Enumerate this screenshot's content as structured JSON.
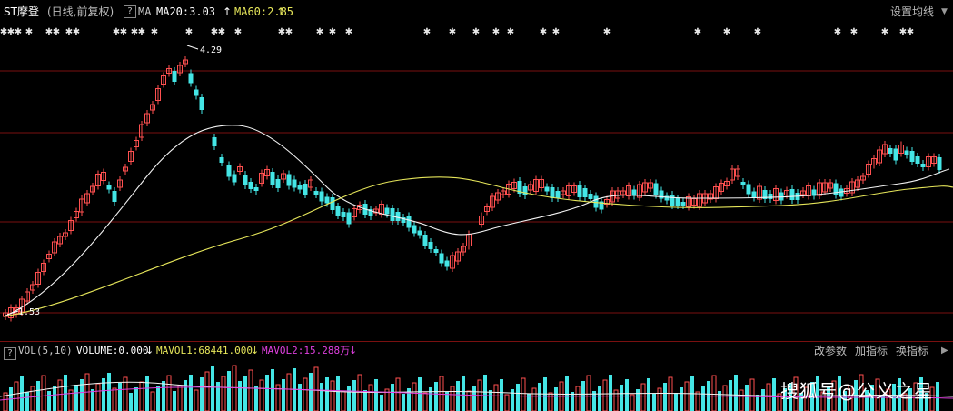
{
  "header": {
    "stock_name": "ST摩登",
    "period": "(日线,前复权)",
    "help_icon": "?",
    "indicator": "MA",
    "ma20_label": "MA20:3.03",
    "ma20_arrow": "↑",
    "ma60_label": "MA60:2.85",
    "ma60_arrow": "↑",
    "settings_label": "设置均线",
    "settings_arrow": "▼"
  },
  "main_chart": {
    "price_high_label": "4.29",
    "price_low_label": "1.53",
    "colors": {
      "up": "#ff5050",
      "down": "#44e6e6",
      "ma20": "#f2f2f2",
      "ma60": "#e6e65a",
      "gridline": "#7a1010",
      "star": "#e8e8e8"
    }
  },
  "volume_bar": {
    "icon": "?",
    "title": "VOL(5,10)",
    "volume_label": "VOLUME:0.000",
    "volume_arrow": "↓",
    "mavol1_label": "MAVOL1:68441.000",
    "mavol1_arrow": "↓",
    "mavol2_label": "MAVOL2:15.288万",
    "mavol2_arrow": "↓",
    "btn_params": "改参数",
    "btn_add_indicator": "加指标",
    "btn_switch_indicator": "换指标",
    "btn_scroll": "▶"
  },
  "watermark": "搜狐号@公义之星"
}
